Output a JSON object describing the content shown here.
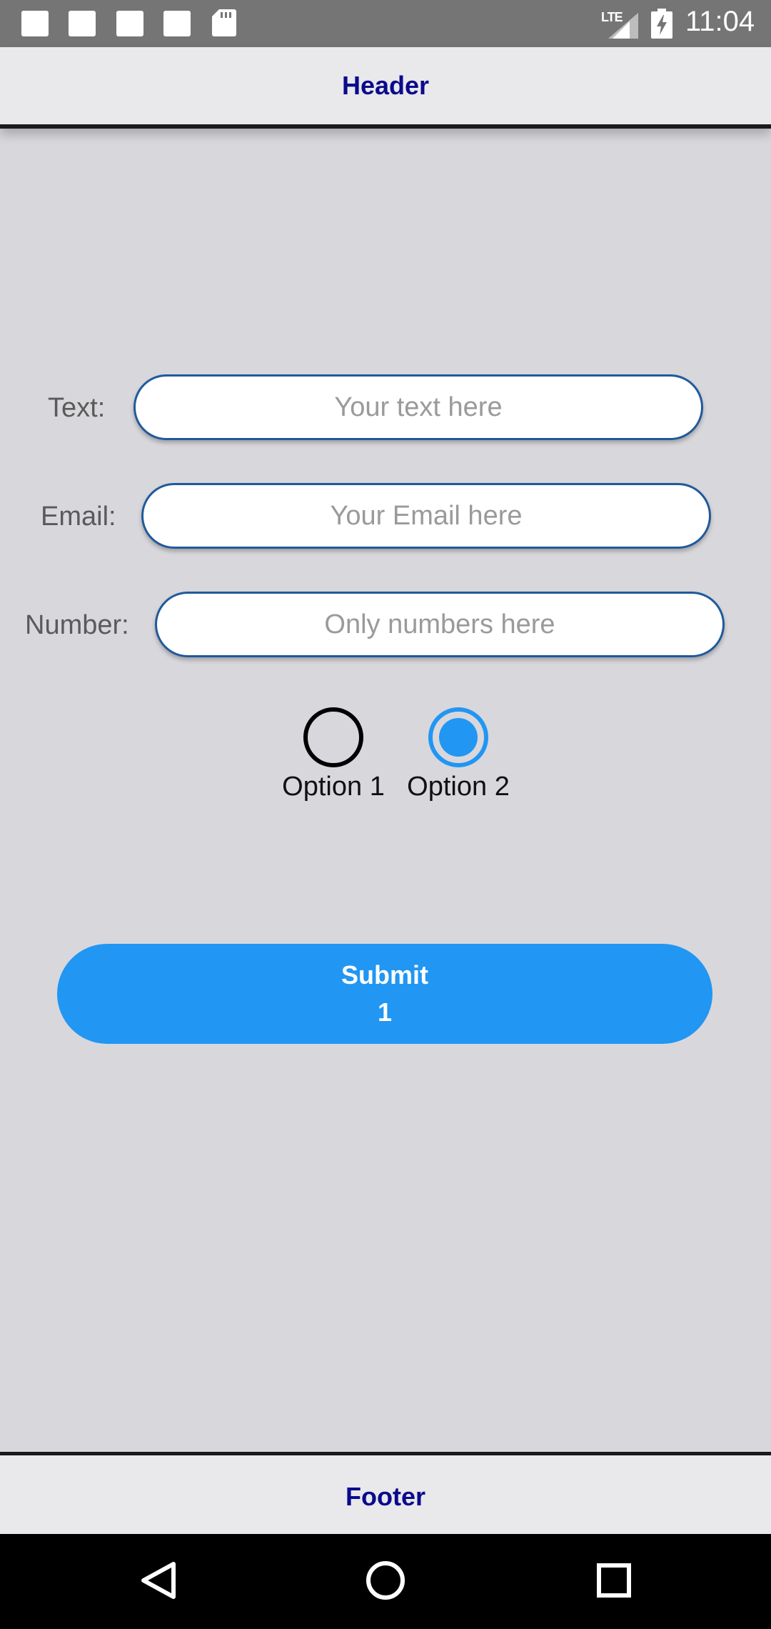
{
  "status_bar": {
    "time": "11:04",
    "network": "LTE",
    "icons": [
      "notification-icon",
      "notification-icon",
      "notification-icon",
      "notification-icon",
      "sd-card-icon",
      "signal-icon",
      "battery-charging-icon"
    ]
  },
  "header": {
    "title": "Header"
  },
  "form": {
    "text": {
      "label": "Text:",
      "placeholder": "Your text here"
    },
    "email": {
      "label": "Email:",
      "placeholder": "Your Email here"
    },
    "number": {
      "label": "Number:",
      "placeholder": "Only numbers here"
    },
    "options": [
      {
        "label": "Option 1",
        "selected": false
      },
      {
        "label": "Option 2",
        "selected": true
      }
    ],
    "submit": {
      "label": "Submit",
      "count": "1"
    }
  },
  "footer": {
    "title": "Footer"
  },
  "nav_bar": {
    "buttons": [
      "back-icon",
      "home-icon",
      "recents-icon"
    ]
  },
  "colors": {
    "accent": "#2196f3",
    "header_text": "#0a0a8c",
    "field_border": "#1f5a9c",
    "background": "#d8d7dc"
  }
}
